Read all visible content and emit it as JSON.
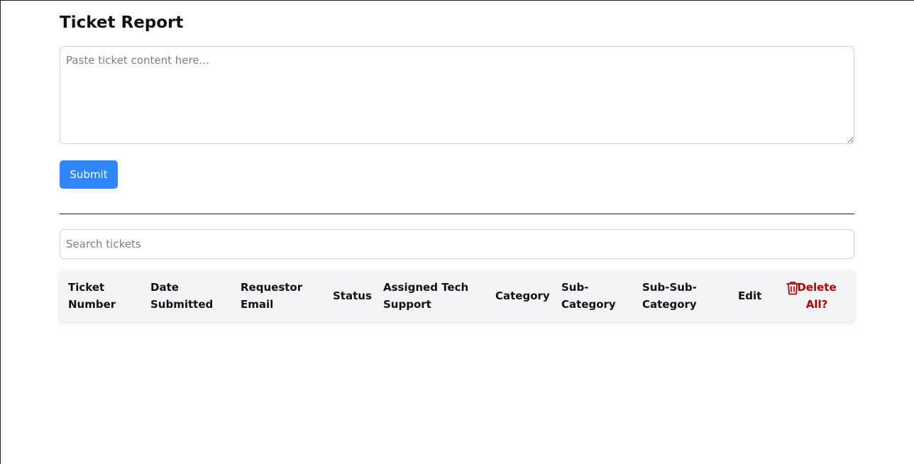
{
  "page": {
    "title": "Ticket Report"
  },
  "form": {
    "textarea_placeholder": "Paste ticket content here...",
    "submit_label": "Submit"
  },
  "search": {
    "placeholder": "Search tickets"
  },
  "table": {
    "headers": {
      "ticket_number": "Ticket Number",
      "date_submitted": "Date Submitted",
      "requestor_email": "Requestor Email",
      "status": "Status",
      "assigned_tech": "Assigned Tech Support",
      "category": "Category",
      "sub_category": "Sub-Category",
      "sub_sub_category": "Sub-Sub-Category",
      "edit": "Edit",
      "delete_all": "Delete All?"
    }
  },
  "icons": {
    "delete_all": "trash-icon"
  },
  "colors": {
    "primary": "#2f86ff",
    "danger": "#b30000",
    "header_bg": "#f2f4f6"
  }
}
